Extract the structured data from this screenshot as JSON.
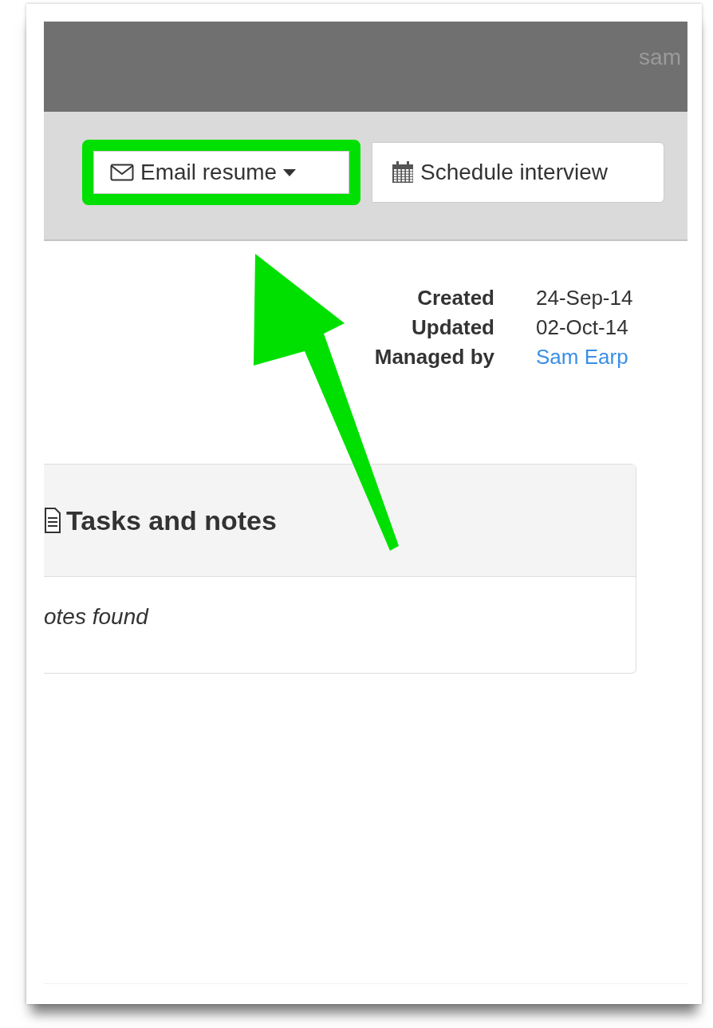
{
  "top_bar": {
    "user": "sam"
  },
  "actions": [
    {
      "label": "Email resume",
      "kind": "dropdown",
      "highlighted": true
    },
    {
      "label": "Schedule interview",
      "kind": "calendar",
      "highlighted": false
    }
  ],
  "meta": [
    {
      "label": "Created",
      "value": "24-Sep-14",
      "kind": "text"
    },
    {
      "label": "Updated",
      "value": "02-Oct-14",
      "kind": "text"
    },
    {
      "label": "Managed by",
      "value": "Sam Earp",
      "kind": "link"
    }
  ],
  "panel": {
    "title": "Tasks and notes",
    "empty_text": "otes found"
  }
}
